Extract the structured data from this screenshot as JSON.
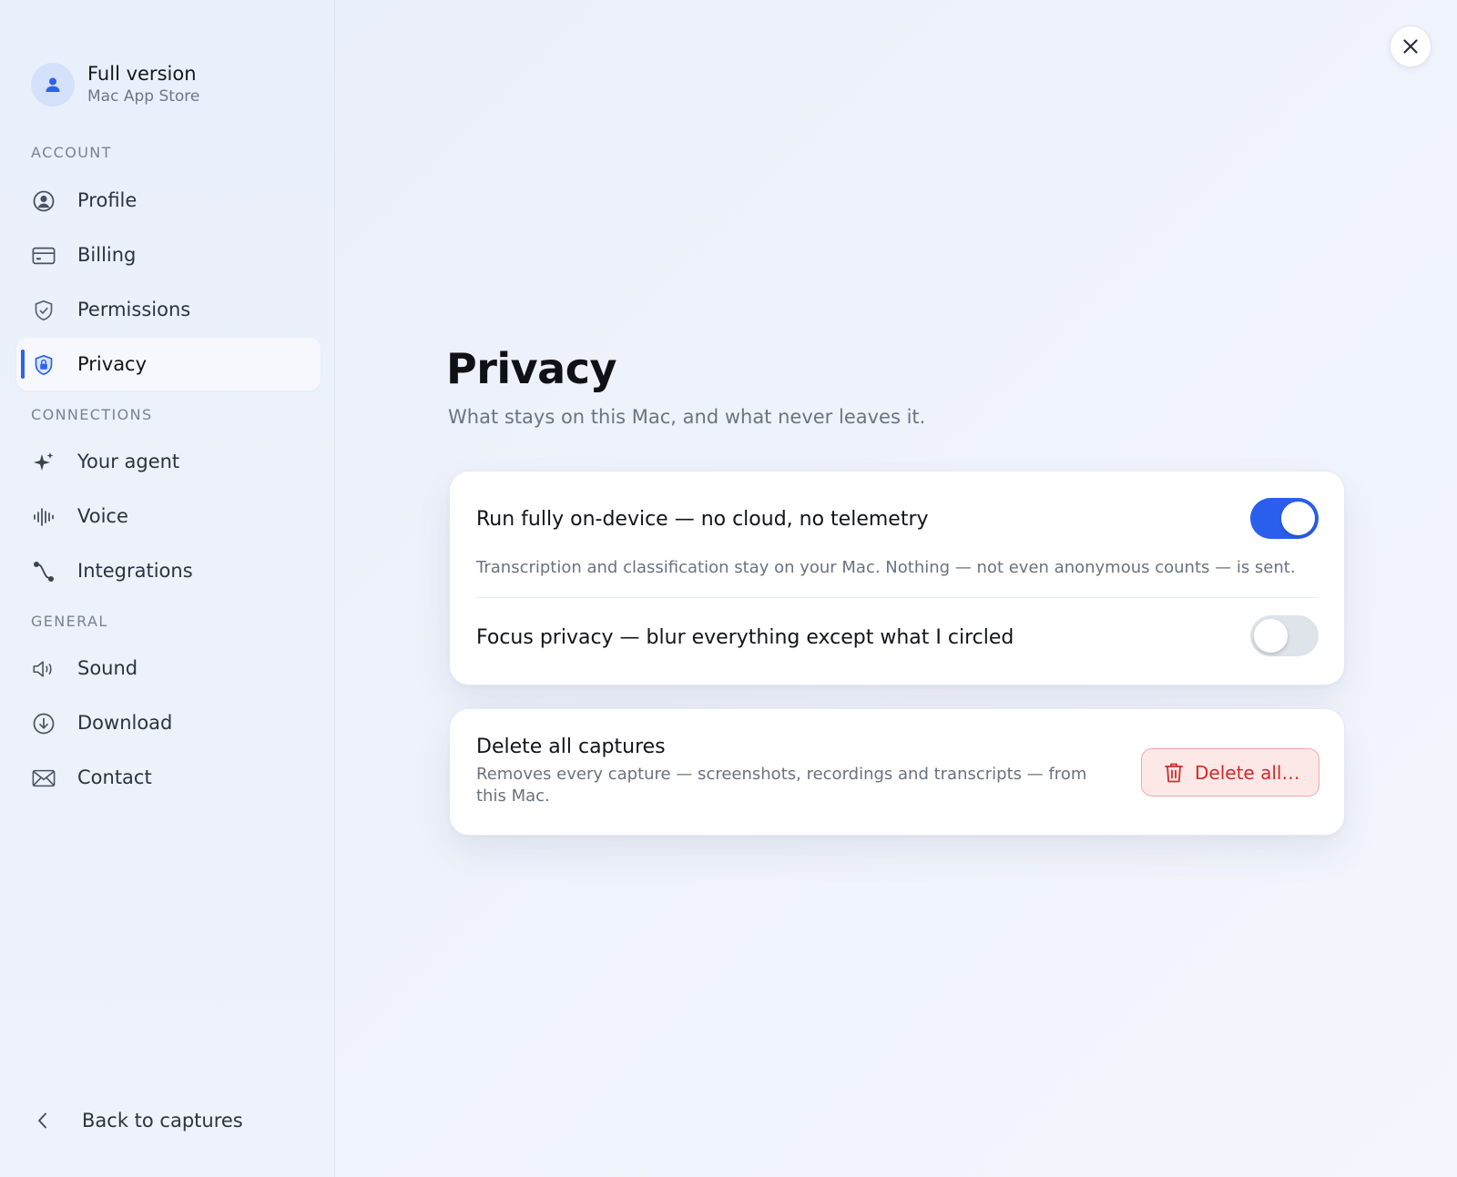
{
  "account": {
    "title": "Full version",
    "subtitle": "Mac App Store",
    "avatar_icon": "person-icon"
  },
  "sidebar": {
    "sections": [
      {
        "label": "ACCOUNT",
        "items": [
          {
            "label": "Profile",
            "icon": "user-circle-icon"
          },
          {
            "label": "Billing",
            "icon": "credit-card-icon"
          },
          {
            "label": "Permissions",
            "icon": "shield-check-icon"
          },
          {
            "label": "Privacy",
            "icon": "shield-lock-icon",
            "active": true
          }
        ]
      },
      {
        "label": "CONNECTIONS",
        "items": [
          {
            "label": "Your agent",
            "icon": "sparkle-icon"
          },
          {
            "label": "Voice",
            "icon": "waveform-icon"
          },
          {
            "label": "Integrations",
            "icon": "connection-icon"
          }
        ]
      },
      {
        "label": "GENERAL",
        "items": [
          {
            "label": "Sound",
            "icon": "speaker-icon"
          },
          {
            "label": "Download",
            "icon": "download-icon"
          },
          {
            "label": "Contact",
            "icon": "envelope-icon"
          }
        ]
      }
    ],
    "back_label": "Back to captures"
  },
  "page": {
    "title": "Privacy",
    "subtitle": "What stays on this Mac, and what never leaves it."
  },
  "settings": {
    "on_device": {
      "title": "Run fully on-device — no cloud, no telemetry",
      "description": "Transcription and classification stay on your Mac. Nothing — not even anonymous counts — is sent.",
      "enabled": true
    },
    "focus_privacy": {
      "title": "Focus privacy — blur everything except what I circled",
      "enabled": false
    }
  },
  "delete_section": {
    "title": "Delete all captures",
    "description": "Removes every capture — screenshots, recordings and transcripts — from this Mac.",
    "button_label": "Delete all…"
  },
  "colors": {
    "accent": "#2a5fee",
    "danger": "#d62828",
    "danger_bg": "#fde8e8"
  }
}
